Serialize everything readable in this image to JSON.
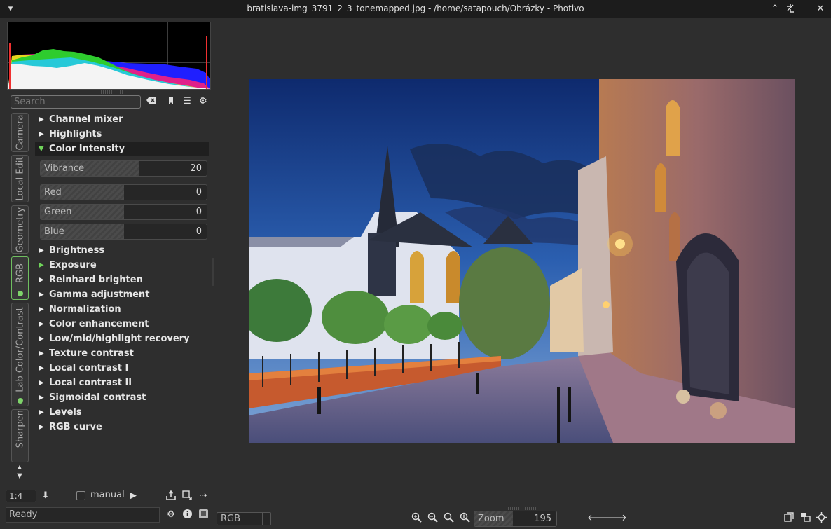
{
  "window": {
    "title": "bratislava-img_3791_2_3_tonemapped.jpg - /home/satapouch/Obrázky - Photivo"
  },
  "search": {
    "placeholder": "Search"
  },
  "tabs": [
    {
      "label": "Camera",
      "active": false,
      "has_dot": false
    },
    {
      "label": "Local Edit",
      "active": false,
      "has_dot": false
    },
    {
      "label": "Geometry",
      "active": false,
      "has_dot": false
    },
    {
      "label": "RGB",
      "active": true,
      "has_dot": true
    },
    {
      "label": "Lab Color/Contrast",
      "active": false,
      "has_dot": true
    },
    {
      "label": "Sharpen/Noise",
      "active": false,
      "has_dot": false
    }
  ],
  "tools": {
    "channel_mixer": "Channel mixer",
    "highlights": "Highlights",
    "color_intensity": "Color Intensity",
    "brightness": "Brightness",
    "exposure": "Exposure",
    "reinhard": "Reinhard brighten",
    "gamma": "Gamma adjustment",
    "normalization": "Normalization",
    "color_enhancement": "Color enhancement",
    "low_mid_high": "Low/mid/highlight recovery",
    "texture_contrast": "Texture contrast",
    "local_contrast_1": "Local contrast I",
    "local_contrast_2": "Local contrast II",
    "sigmoidal": "Sigmoidal contrast",
    "levels": "Levels",
    "rgb_curve": "RGB curve"
  },
  "color_intensity": {
    "vibrance": {
      "label": "Vibrance",
      "value": "20",
      "fraction": 0.59
    },
    "red": {
      "label": "Red",
      "value": "0",
      "fraction": 0.5
    },
    "green": {
      "label": "Green",
      "value": "0",
      "fraction": 0.5
    },
    "blue": {
      "label": "Blue",
      "value": "0",
      "fraction": 0.5
    }
  },
  "bottom": {
    "pipe_size": "1:4",
    "manual_label": "manual",
    "status": "Ready",
    "channel": "RGB",
    "zoom_label": "Zoom",
    "zoom_value": "195"
  },
  "icons": {
    "menu": "menu-icon",
    "minimize": "minimize-icon",
    "maximize": "maximize-icon",
    "close": "close-icon"
  }
}
